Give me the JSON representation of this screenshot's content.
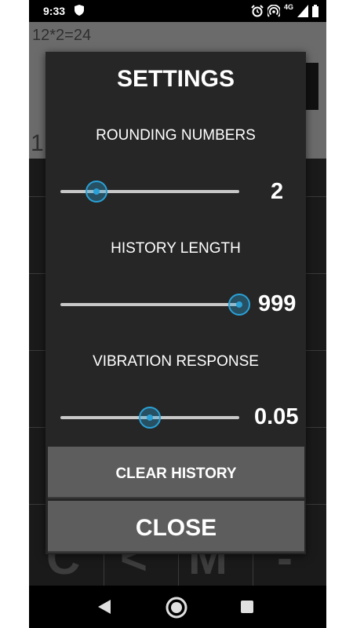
{
  "status_bar": {
    "time": "9:33",
    "network": "4G"
  },
  "calculator": {
    "expression": "12*2=24",
    "result_partial": "1"
  },
  "dialog": {
    "title": "SETTINGS",
    "settings": [
      {
        "label": "ROUNDING NUMBERS",
        "value": "2",
        "slider_fraction": 0.2
      },
      {
        "label": "HISTORY LENGTH",
        "value": "999",
        "slider_fraction": 1.0
      },
      {
        "label": "VIBRATION RESPONSE",
        "value": "0.05",
        "slider_fraction": 0.5
      }
    ],
    "clear_history_label": "CLEAR HISTORY",
    "close_label": "CLOSE"
  },
  "colors": {
    "accent": "#2aa1d6",
    "dialog_bg": "#262626",
    "button_bg": "#5d5d5d"
  },
  "icons": {
    "status": [
      "shield-icon",
      "alarm-icon",
      "hotspot-icon",
      "signal-icon",
      "battery-icon"
    ],
    "nav": [
      "back-icon",
      "home-icon",
      "recents-icon"
    ]
  }
}
